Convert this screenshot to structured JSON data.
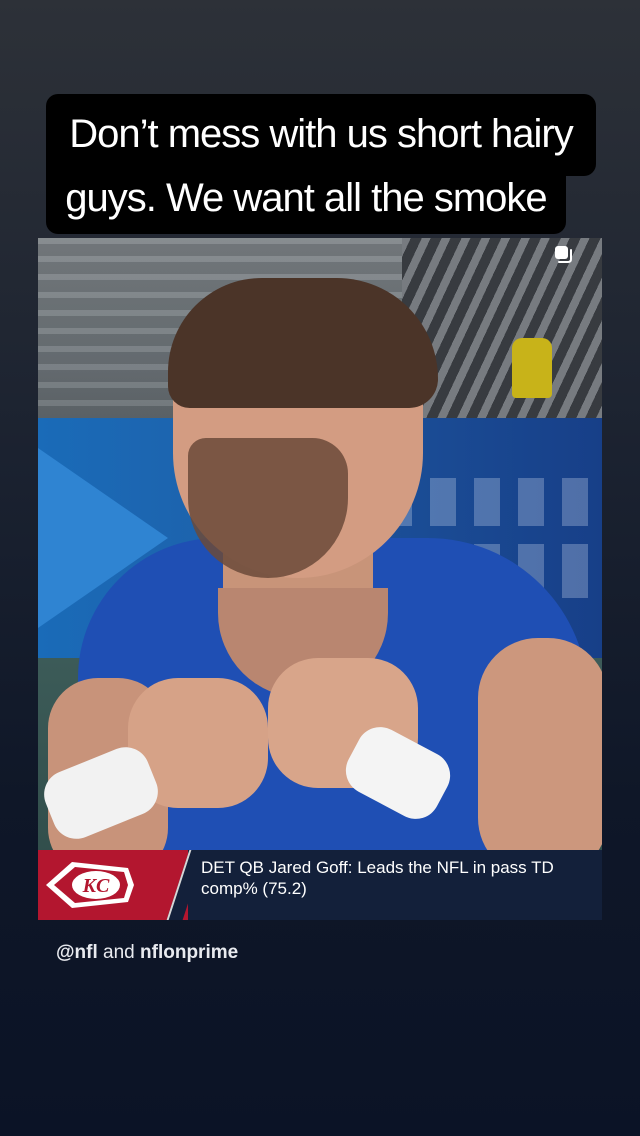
{
  "caption": {
    "line1": "Don’t mess with us short hairy",
    "line2": "guys. We want all the smoke"
  },
  "video": {
    "ticker": {
      "line1": "DET QB Jared Goff: Leads the NFL in pass TD",
      "line2": "comp% (75.2)",
      "logo_text": "KC",
      "logo_colors": {
        "background": "#b3162f",
        "arrowhead": "#ffffff"
      }
    },
    "icons": {
      "stack": "multi-media-stack-icon"
    }
  },
  "attribution": {
    "account1": "@nfl",
    "conjunction": "and",
    "account2": "nflonprime"
  }
}
